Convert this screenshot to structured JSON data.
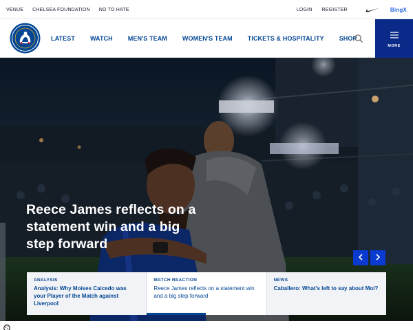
{
  "utility_bar": {
    "links": [
      "VENUE",
      "CHELSEA FOUNDATION",
      "NO TO HATE"
    ],
    "login": "LOGIN",
    "register": "REGISTER",
    "partner_icon": "nike-swoosh-icon",
    "partner_text": "BingX"
  },
  "nav": {
    "logo_text": "CHELSEA",
    "items": [
      "LATEST",
      "WATCH",
      "MEN'S TEAM",
      "WOMEN'S TEAM",
      "TICKETS & HOSPITALITY",
      "SHOP"
    ],
    "search_icon": "search-icon",
    "more_label": "MORE",
    "brand_color": "#034694",
    "more_bg": "#0a2a8a"
  },
  "hero": {
    "headline": "Reece James reflects on a statement win and a big step forward",
    "prev_icon": "chevron-left-icon",
    "next_icon": "chevron-right-icon",
    "arrow_color": "#0a3ad0"
  },
  "cards": [
    {
      "category": "ANALYSIS",
      "title": "Analysis: Why Moises Caicedo was your Player of the Match against Liverpool"
    },
    {
      "category": "MATCH REACTION",
      "title": "Reece James reflects on a statement win and a big step forward"
    },
    {
      "category": "NEWS",
      "title": "Caballero: What's left to say about Moi?"
    }
  ],
  "cookie_icon": "cookie-icon"
}
